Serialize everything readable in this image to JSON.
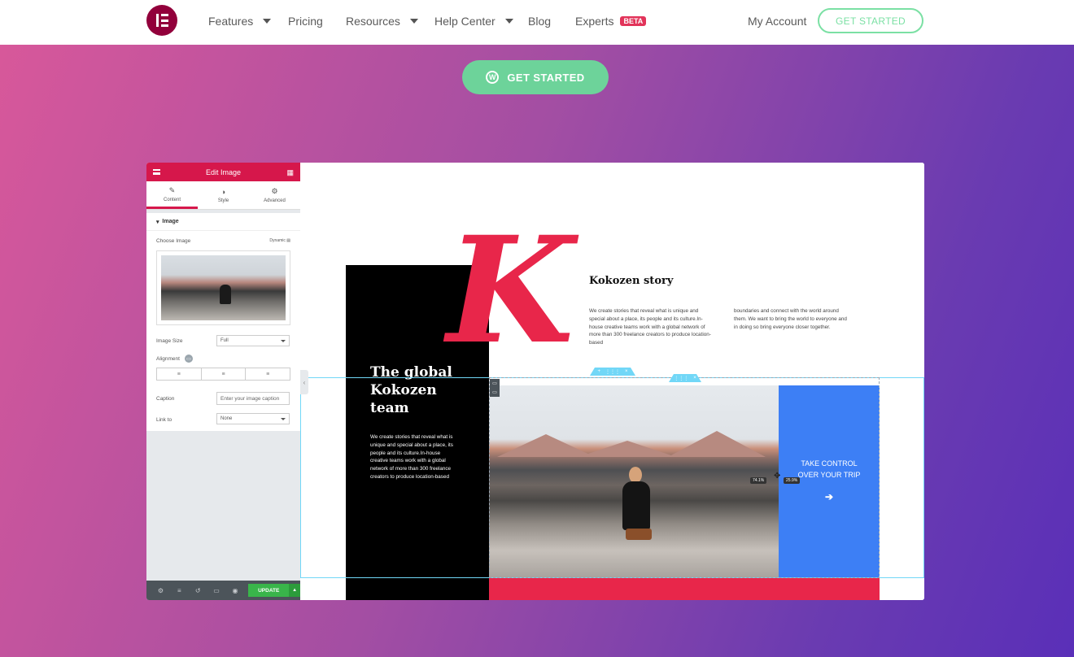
{
  "nav": {
    "items": [
      "Features",
      "Pricing",
      "Resources",
      "Help Center",
      "Blog",
      "Experts"
    ],
    "beta_badge": "BETA",
    "my_account": "My Account",
    "get_started": "GET STARTED"
  },
  "hero": {
    "cta": "GET STARTED"
  },
  "panel": {
    "title": "Edit Image",
    "tabs": [
      "Content",
      "Style",
      "Advanced"
    ],
    "section": "Image",
    "choose_image": "Choose Image",
    "dynamic": "Dynamic",
    "image_size_label": "Image Size",
    "image_size_value": "Full",
    "alignment_label": "Alignment",
    "caption_label": "Caption",
    "caption_placeholder": "Enter your image caption",
    "link_label": "Link to",
    "link_value": "None",
    "update": "UPDATE"
  },
  "canvas": {
    "big_letter": "K",
    "story_title": "Kokozen story",
    "story_col1": "We create stories that reveal what is unique and special about a place, its people and its culture.In-house creative teams work with a global network of more than 300 freelance creators to produce location-based",
    "story_col2": "boundaries and connect with the world around them. We want to bring the world to everyone and in doing so bring everyone closer together.",
    "team_title": "The global Kokozen team",
    "team_text": "We create stories that reveal what is unique and special about a place, its people and its culture.In-house creative teams work with a global network of more than 300 freelance creators to produce location-based",
    "cta_text": "TAKE CONTROL\nOVER YOUR TRIP",
    "cta_arrow": "➔",
    "pct_left": "74.1%",
    "pct_right": "25.9%"
  },
  "colors": {
    "brand": "#92003b",
    "accent_red": "#e8264a",
    "green": "#6dd39a",
    "blue": "#3d7ff5"
  }
}
